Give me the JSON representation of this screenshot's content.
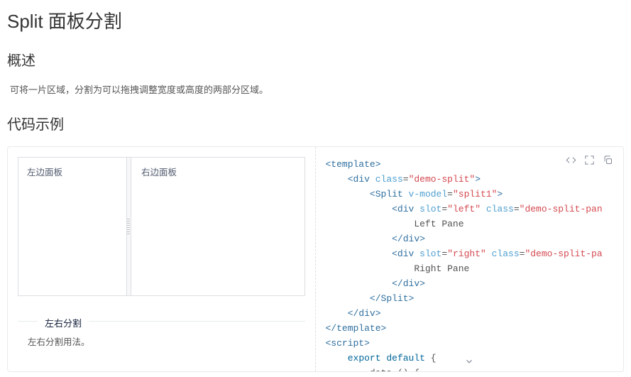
{
  "title": "Split 面板分割",
  "overview": {
    "heading": "概述",
    "text": "可将一片区域，分割为可以拖拽调整宽度或高度的两部分区域。"
  },
  "examples_heading": "代码示例",
  "demo": {
    "left_pane": "左边面板",
    "right_pane": "右边面板",
    "title": "左右分割",
    "desc": "左右分割用法。"
  },
  "code": {
    "left_pane_text": "Left Pane",
    "right_pane_text": "Right Pane",
    "class_demo_split": "\"demo-split\"",
    "vmodel": "\"split1\"",
    "slot_left": "\"left\"",
    "slot_right": "\"right\"",
    "class_pane_left": "\"demo-split-pan",
    "class_pane_right": "\"demo-split-pa",
    "data_fn": "data () {"
  }
}
